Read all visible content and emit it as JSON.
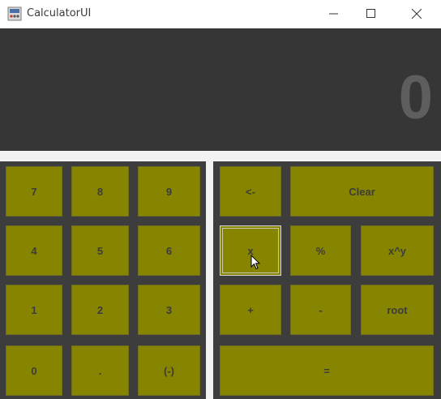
{
  "window": {
    "title": "CalculatorUI",
    "icon": "app-icon",
    "controls": [
      "minimize-icon",
      "maximize-icon",
      "close-icon"
    ]
  },
  "display": {
    "value": "0"
  },
  "colors": {
    "key_bg": "#878400",
    "key_text": "#3c3c3c",
    "display_bg": "#363636",
    "display_text": "#5e5e5e",
    "panel_bg": "#3d3d3d"
  },
  "keypad": {
    "numbers": [
      {
        "label": "7"
      },
      {
        "label": "8"
      },
      {
        "label": "9"
      },
      {
        "label": "4"
      },
      {
        "label": "5"
      },
      {
        "label": "6"
      },
      {
        "label": "1"
      },
      {
        "label": "2"
      },
      {
        "label": "3"
      },
      {
        "label": "0"
      },
      {
        "label": "."
      },
      {
        "label": "(-)"
      }
    ],
    "operators": [
      {
        "label": "<-"
      },
      {
        "label": "Clear"
      },
      {
        "label": "x"
      },
      {
        "label": "%"
      },
      {
        "label": "x^y"
      },
      {
        "label": "+"
      },
      {
        "label": "-"
      },
      {
        "label": "root"
      },
      {
        "label": "="
      }
    ]
  }
}
